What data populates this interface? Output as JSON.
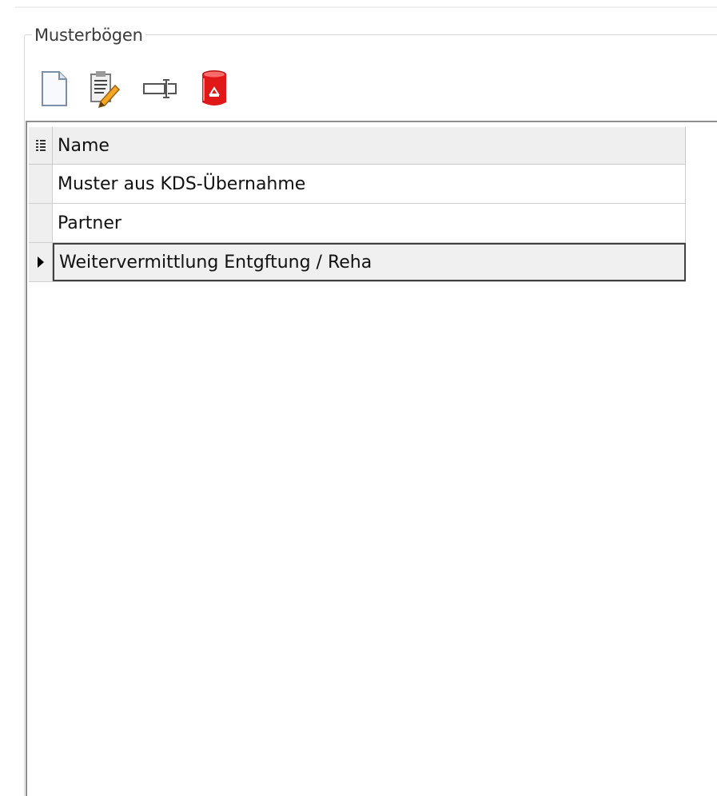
{
  "panel": {
    "title": "Musterbögen"
  },
  "toolbar": {
    "buttons": [
      {
        "name": "new-document-button",
        "icon": "blank-page-icon"
      },
      {
        "name": "edit-button",
        "icon": "edit-document-pencil-icon"
      },
      {
        "name": "rename-button",
        "icon": "text-cursor-field-icon"
      },
      {
        "name": "delete-button",
        "icon": "red-recycle-bin-icon"
      }
    ]
  },
  "grid": {
    "columns": [
      {
        "label": "Name"
      }
    ],
    "rows": [
      {
        "name": "Muster aus KDS-Übernahme",
        "selected": false
      },
      {
        "name": "Partner",
        "selected": false
      },
      {
        "name": "Weitervermittlung Entgftung / Reha",
        "selected": true
      }
    ]
  },
  "colors": {
    "header_bg": "#efefef",
    "selected_border": "#404040",
    "frame_border": "#8f8f8f",
    "recycle_red": "#e01818"
  }
}
